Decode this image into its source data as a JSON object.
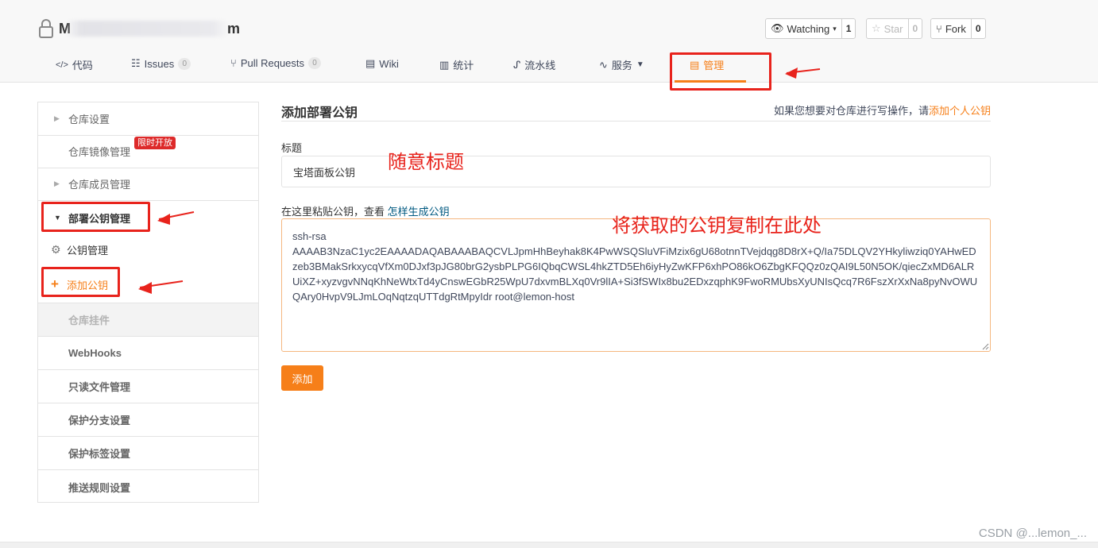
{
  "header": {
    "repo_name_start": "M",
    "repo_name_end": "m",
    "watching_label": "Watching",
    "watching_count": "1",
    "star_label": "Star",
    "star_count": "0",
    "fork_label": "Fork",
    "fork_count": "0"
  },
  "tabs": [
    {
      "icon": "</>",
      "label": "代码"
    },
    {
      "icon": "☷",
      "label": "Issues",
      "badge": "0"
    },
    {
      "icon": "⑂",
      "label": "Pull Requests",
      "badge": "0"
    },
    {
      "icon": "▤",
      "label": "Wiki"
    },
    {
      "icon": "▥",
      "label": "统计"
    },
    {
      "icon": "ᔑ",
      "label": "流水线"
    },
    {
      "icon": "∿",
      "label": "服务"
    },
    {
      "icon": "▤",
      "label": "管理"
    }
  ],
  "sidebar": {
    "items": [
      {
        "label": "仓库设置"
      },
      {
        "label": "仓库镜像管理"
      },
      {
        "label": "仓库成员管理"
      },
      {
        "label": "部署公钥管理"
      },
      {
        "label": "公钥管理"
      },
      {
        "label": "添加公钥"
      },
      {
        "label": "仓库挂件"
      },
      {
        "label": "WebHooks"
      },
      {
        "label": "只读文件管理"
      },
      {
        "label": "保护分支设置"
      },
      {
        "label": "保护标签设置"
      },
      {
        "label": "推送规则设置"
      }
    ],
    "limited_badge": "限时开放"
  },
  "main": {
    "title": "添加部署公钥",
    "hint_text": "如果您想要对仓库进行写操作，请",
    "hint_link": "添加个人公钥",
    "title_label": "标题",
    "title_value": "宝塔面板公钥",
    "key_label": "在这里粘贴公钥，查看",
    "key_link": "怎样生成公钥",
    "key_value": "ssh-rsa\nAAAAB3NzaC1yc2EAAAADAQABAAABAQCVLJpmHhBeyhak8K4PwWSQSluVFiMzix6gU68otnnTVejdqg8D8rX+Q/Ia75DLQV2YHkyliwziq0YAHwEDzeb3BMakSrkxycqVfXm0DJxf3pJG80brG2ysbPLPG6IQbqCWSL4hkZTD5Eh6iyHyZwKFP6xhPO86kO6ZbgKFQQz0zQAI9L50N5OK/qiecZxMD6ALRUiXZ+xyzvgvNNqKhNeWtxTd4yCnswEGbR25WpU7dxvmBLXq0Vr9lIA+Si3fSWIx8bu2EDxzqphK9FwoRMUbsXyUNIsQcq7R6FszXrXxNa8pyNvOWUQAry0HvpV9LJmLOqNqtzqUTTdgRtMpyIdr root@lemon-host",
    "submit_label": "添加"
  },
  "annotations": {
    "title_note": "随意标题",
    "key_note": "将获取的公钥复制在此处"
  },
  "watermark": "CSDN @...lemon_...",
  "colors": {
    "accent": "#f67f19",
    "annotation_red": "#e8231c",
    "badge_red": "#dd2a2a",
    "link_blue": "#005980"
  }
}
